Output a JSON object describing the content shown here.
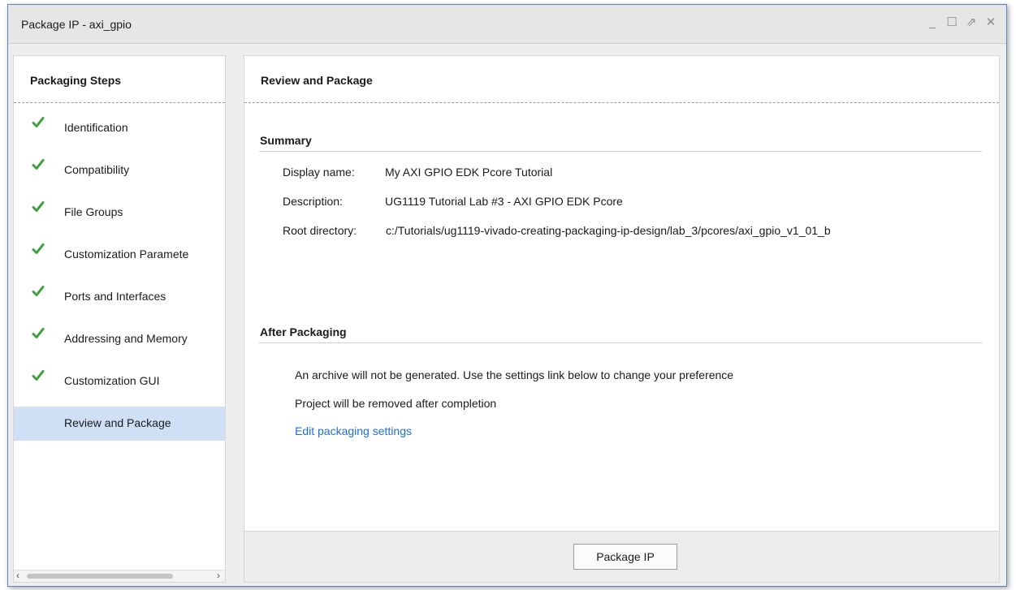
{
  "window": {
    "title": "Package IP - axi_gpio",
    "controls": [
      "minimize-icon",
      "maximize-icon",
      "restore-icon",
      "close-icon"
    ]
  },
  "left_panel": {
    "header": "Packaging Steps",
    "steps": [
      {
        "label": "Identification",
        "done": true
      },
      {
        "label": "Compatibility",
        "done": true
      },
      {
        "label": "File Groups",
        "done": true
      },
      {
        "label": "Customization Paramete",
        "done": true
      },
      {
        "label": "Ports and Interfaces",
        "done": true
      },
      {
        "label": "Addressing and Memory",
        "done": true
      },
      {
        "label": "Customization GUI",
        "done": true
      },
      {
        "label": "Review and Package",
        "done": false,
        "selected": true
      }
    ]
  },
  "right_panel": {
    "header": "Review and Package",
    "summary": {
      "title": "Summary",
      "display_name_label": "Display name:",
      "display_name": "My AXI GPIO EDK Pcore Tutorial",
      "description_label": "Description:",
      "description": "UG1119 Tutorial Lab #3 - AXI GPIO EDK Pcore",
      "root_dir_label": "Root directory:",
      "root_dir": "c:/Tutorials/ug1119-vivado-creating-packaging-ip-design/lab_3/pcores/axi_gpio_v1_01_b"
    },
    "after_packaging": {
      "title": "After Packaging",
      "line1": "An archive will not be generated. Use the settings link below to change your preference",
      "line2": "Project will be removed after completion",
      "link": "Edit packaging settings"
    },
    "button": "Package IP"
  },
  "colors": {
    "check": "#3aa13a",
    "selected_bg": "#cfe0f6",
    "link": "#1f6fd1",
    "window_border": "#5a83c4"
  }
}
